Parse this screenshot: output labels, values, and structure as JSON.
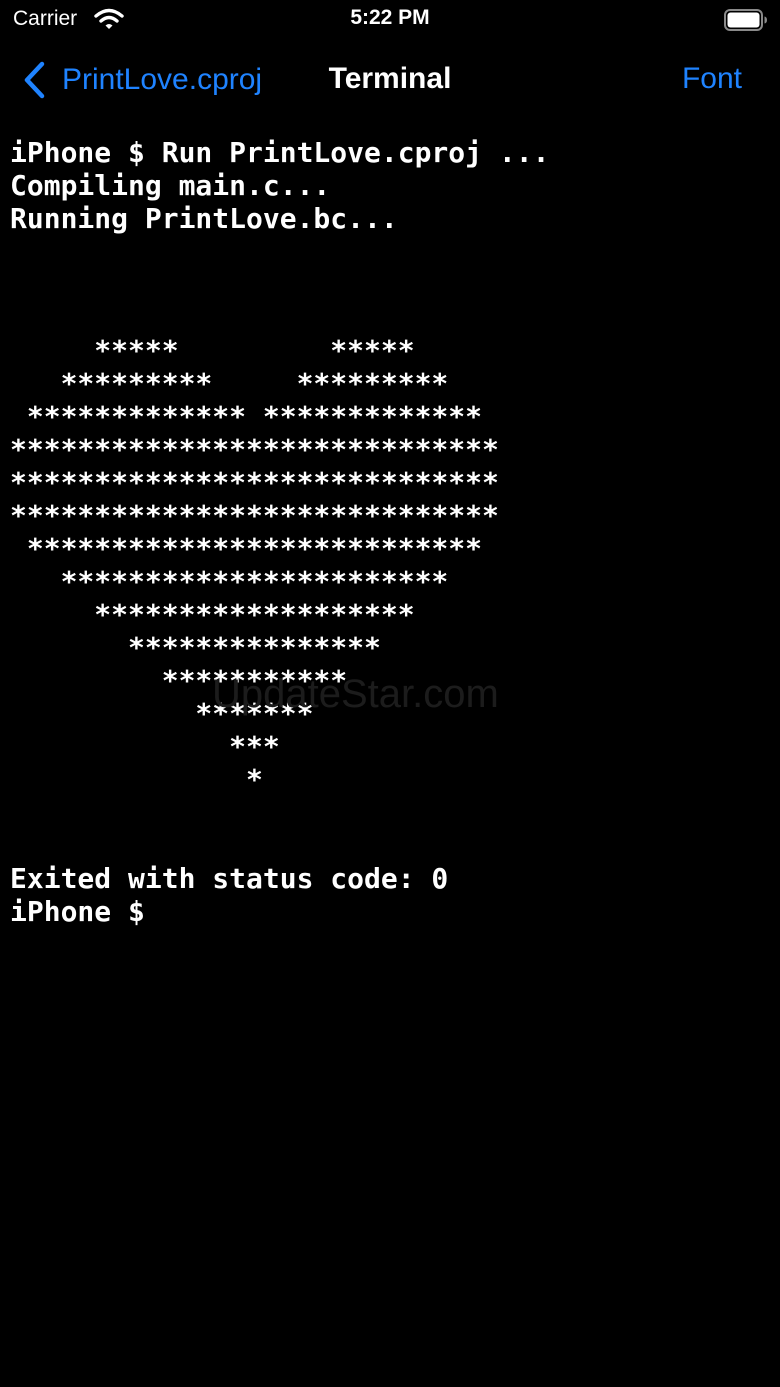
{
  "status_bar": {
    "carrier": "Carrier",
    "time": "5:22 PM",
    "wifi_icon": "wifi-icon",
    "battery_icon": "battery-icon",
    "battery_level": 1.0
  },
  "nav": {
    "back_label": "PrintLove.cproj",
    "title": "Terminal",
    "font_label": "Font",
    "accent_color": "#1f83ff"
  },
  "terminal": {
    "background": "#000000",
    "text_color": "#ffffff",
    "output": "iPhone $ Run PrintLove.cproj ...\nCompiling main.c...\nRunning PrintLove.bc...\n\n\n\n     *****         *****\n   *********     *********\n ************* *************\n*****************************\n*****************************\n*****************************\n ***************************\n   ***********************\n     *******************\n       ***************\n         ***********\n           *******\n             ***\n              *\n\n\nExited with status code: 0\niPhone $"
  },
  "watermark": "UpdateStar.com"
}
